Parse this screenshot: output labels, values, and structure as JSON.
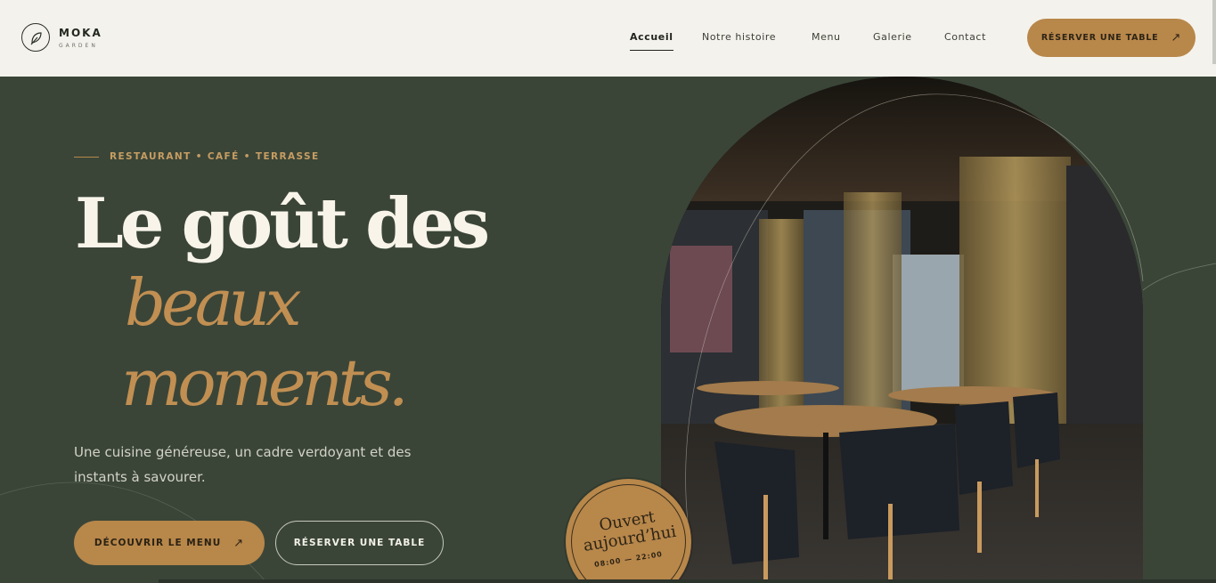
{
  "brand": {
    "name": "MOKA",
    "sub": "GARDEN"
  },
  "nav": [
    {
      "label": "Accueil",
      "active": true
    },
    {
      "label": "Notre histoire",
      "active": false
    },
    {
      "label": "Menu",
      "active": false
    },
    {
      "label": "Galerie",
      "active": false
    },
    {
      "label": "Contact",
      "active": false
    }
  ],
  "header_cta": {
    "label": "RÉSERVER UNE TABLE",
    "icon": "arrow-up-right-icon"
  },
  "hero": {
    "eyebrow": "RESTAURANT • CAFÉ • TERRASSE",
    "title_line1": "Le goût des",
    "title_line2": "beaux",
    "title_line3": "moments.",
    "lede": "Une cuisine généreuse, un cadre verdoyant et des instants à savourer.",
    "primary_button": "DÉCOUVRIR LE MENU",
    "secondary_button": "RÉSERVER UNE TABLE"
  },
  "badge": {
    "title_line1": "Ouvert",
    "title_line2": "aujourd’hui",
    "hours": "08:00 — 22:00"
  },
  "colors": {
    "accent": "#b8874a",
    "background": "#3a4538",
    "header_bg": "#f4f2ec",
    "cream": "#f8f4ea"
  }
}
